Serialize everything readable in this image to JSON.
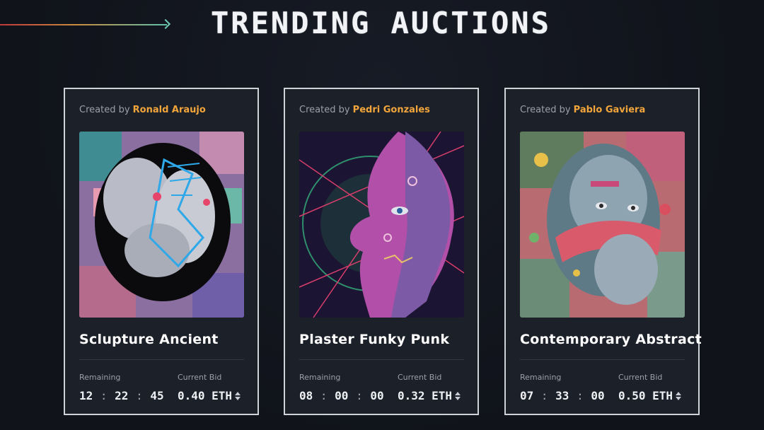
{
  "header": {
    "title": "TRENDING AUCTIONS"
  },
  "labels": {
    "created_by": "Created by",
    "remaining": "Remaining",
    "current_bid": "Current Bid"
  },
  "colors": {
    "accent": "#f2a53a",
    "card_bg": "#1c2029",
    "page_bg": "#12151d"
  },
  "cards": [
    {
      "creator": "Ronald Araujo",
      "title": "Sclupture Ancient",
      "time": {
        "h": "12",
        "m": "22",
        "s": "45"
      },
      "bid": "0.40 ETH"
    },
    {
      "creator": "Pedri Gonzales",
      "title": "Plaster Funky Punk",
      "time": {
        "h": "08",
        "m": "00",
        "s": "00"
      },
      "bid": "0.32 ETH"
    },
    {
      "creator": "Pablo Gaviera",
      "title": "Contemporary Abstract",
      "time": {
        "h": "07",
        "m": "33",
        "s": "00"
      },
      "bid": "0.50 ETH"
    }
  ]
}
